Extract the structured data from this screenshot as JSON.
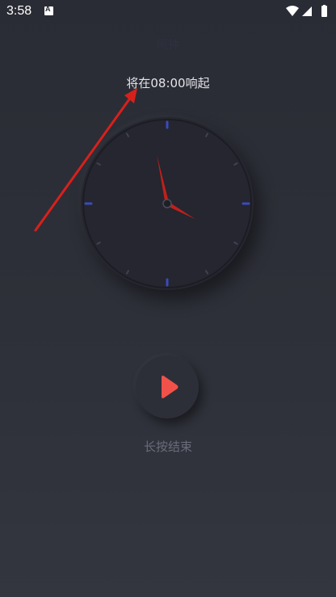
{
  "status_bar": {
    "time": "3:58",
    "app_icon_letter": "A"
  },
  "header": {
    "title": "闹钟"
  },
  "alarm": {
    "ring_text": "将在08:00响起"
  },
  "clock": {
    "hour": 3,
    "minute": 58,
    "colors": {
      "face": "#25262f",
      "major_tick": "#3b4bbd",
      "minor_tick": "#40424d",
      "hand": "#c0201b"
    }
  },
  "control": {
    "play_icon": "play-icon",
    "play_color": "#f0524a"
  },
  "hint": {
    "label": "长按结束"
  },
  "annotation": {
    "color": "#d8201b"
  }
}
